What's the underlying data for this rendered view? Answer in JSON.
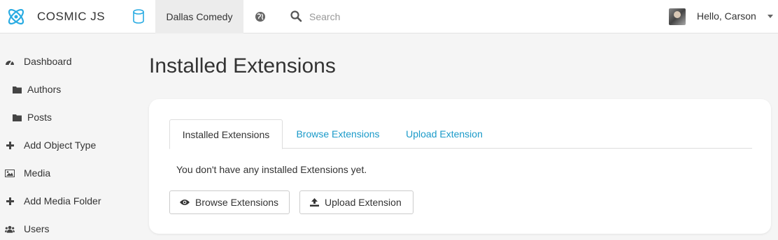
{
  "header": {
    "brand": "COSMIC JS",
    "bucket": "Dallas Comedy",
    "search_placeholder": "Search",
    "user_greeting": "Hello, Carson"
  },
  "sidebar": {
    "items": [
      {
        "label": "Dashboard",
        "icon": "dashboard-icon"
      },
      {
        "label": "Authors",
        "icon": "folder-icon"
      },
      {
        "label": "Posts",
        "icon": "folder-icon"
      },
      {
        "label": "Add Object Type",
        "icon": "plus-icon"
      },
      {
        "label": "Media",
        "icon": "image-icon"
      },
      {
        "label": "Add Media Folder",
        "icon": "plus-icon"
      },
      {
        "label": "Users",
        "icon": "users-icon"
      }
    ]
  },
  "main": {
    "title": "Installed Extensions",
    "tabs": [
      {
        "label": "Installed Extensions",
        "active": true
      },
      {
        "label": "Browse Extensions",
        "active": false
      },
      {
        "label": "Upload Extension",
        "active": false
      }
    ],
    "empty_message": "You don't have any installed Extensions yet.",
    "browse_button": "Browse Extensions",
    "upload_button": "Upload Extension"
  },
  "colors": {
    "accent": "#1a9ac9",
    "brand": "#29abe2"
  }
}
